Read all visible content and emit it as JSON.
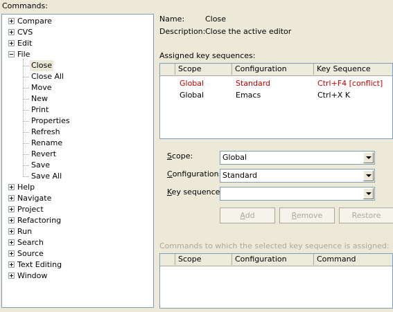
{
  "commands_label": "Commands:",
  "tree": {
    "categories_top": [
      "Compare",
      "CVS",
      "Edit"
    ],
    "file_label": "File",
    "file_children": [
      "Close",
      "Close All",
      "Move",
      "New",
      "Print",
      "Properties",
      "Refresh",
      "Rename",
      "Revert",
      "Save",
      "Save All"
    ],
    "selected": "Close",
    "categories_bottom": [
      "Help",
      "Navigate",
      "Project",
      "Refactoring",
      "Run",
      "Search",
      "Source",
      "Text Editing",
      "Window"
    ]
  },
  "details": {
    "name_label": "Name:",
    "name_value": "Close",
    "description_label": "Description:",
    "description_value": "Close the active editor"
  },
  "assigned": {
    "label": "Assigned key sequences:",
    "columns": [
      "Scope",
      "Configuration",
      "Key Sequence"
    ],
    "rows": [
      {
        "scope": "Global",
        "configuration": "Standard",
        "key_sequence": "Ctrl+F4 [conflict]",
        "conflict": true
      },
      {
        "scope": "Global",
        "configuration": "Emacs",
        "key_sequence": "Ctrl+X K",
        "conflict": false
      }
    ],
    "conflict_color": "#c00000"
  },
  "form": {
    "scope_label": "Scope:",
    "scope_value": "Global",
    "configuration_label": "Configuration:",
    "configuration_value": "Standard",
    "key_sequence_label": "Key sequence:",
    "key_sequence_value": ""
  },
  "buttons": {
    "add": "Add",
    "remove": "Remove",
    "restore": "Restore"
  },
  "commands_assigned": {
    "label": "Commands to which the selected key sequence is assigned:",
    "columns": [
      "Scope",
      "Configuration",
      "Command"
    ]
  }
}
